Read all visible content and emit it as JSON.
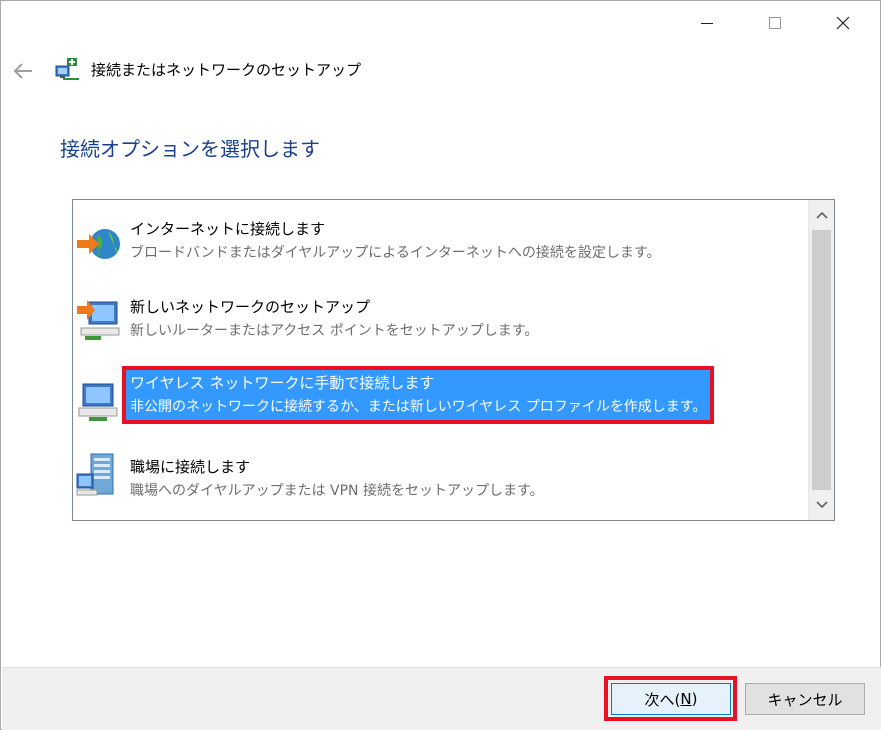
{
  "window": {
    "title": "接続またはネットワークのセットアップ",
    "controls": [
      "minimize-icon",
      "maximize-icon",
      "close-icon"
    ]
  },
  "page": {
    "heading": "接続オプションを選択します"
  },
  "options": [
    {
      "title": "インターネットに接続します",
      "description": "ブロードバンドまたはダイヤルアップによるインターネットへの接続を設定します。",
      "icon": "globe-connect-icon",
      "selected": false
    },
    {
      "title": "新しいネットワークのセットアップ",
      "description": "新しいルーターまたはアクセス ポイントをセットアップします。",
      "icon": "network-setup-icon",
      "selected": false
    },
    {
      "title": "ワイヤレス ネットワークに手動で接続します",
      "description": "非公開のネットワークに接続するか、または新しいワイヤレス プロファイルを作成します。",
      "icon": "wireless-network-icon",
      "selected": true
    },
    {
      "title": "職場に接続します",
      "description": "職場へのダイヤルアップまたは VPN 接続をセットアップします。",
      "icon": "workplace-icon",
      "selected": false
    }
  ],
  "footer": {
    "next_label": "次へ(",
    "next_key": "N",
    "next_close": ")",
    "cancel_label": "キャンセル"
  },
  "colors": {
    "heading": "#1a3f8f",
    "selection": "#3399ff",
    "highlight_frame": "#e81123"
  }
}
